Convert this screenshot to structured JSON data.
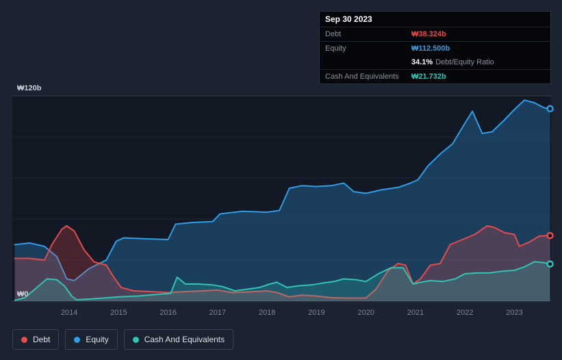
{
  "tooltip": {
    "date": "Sep 30 2023",
    "debt_label": "Debt",
    "debt_value": "₩38.324b",
    "equity_label": "Equity",
    "equity_value": "₩112.500b",
    "ratio_value": "34.1%",
    "ratio_label": "Debt/Equity Ratio",
    "cash_label": "Cash And Equivalents",
    "cash_value": "₩21.732b"
  },
  "legend": {
    "items": [
      {
        "label": "Debt",
        "color": "#e64c4c"
      },
      {
        "label": "Equity",
        "color": "#2f9ee8"
      },
      {
        "label": "Cash And Equivalents",
        "color": "#2fc6b5"
      }
    ]
  },
  "chart_data": {
    "type": "area",
    "title": "",
    "ylabel_top": "₩120b",
    "ylabel_bottom": "₩0",
    "unit": "₩ billions",
    "xlim": [
      2012.85,
      2023.74
    ],
    "ylim": [
      0,
      120
    ],
    "gridlines": [
      120,
      96,
      72,
      48,
      24,
      0
    ],
    "x_ticks": [
      2014,
      2015,
      2016,
      2017,
      2018,
      2019,
      2020,
      2021,
      2022,
      2023
    ],
    "legend_position": "bottom-left",
    "series": [
      {
        "name": "Equity",
        "color": "#2f9ee8",
        "fill": "rgba(47,158,232,0.28)",
        "points": [
          [
            2012.9,
            33
          ],
          [
            2013.2,
            34
          ],
          [
            2013.5,
            32
          ],
          [
            2013.75,
            26
          ],
          [
            2013.95,
            13
          ],
          [
            2014.1,
            12
          ],
          [
            2014.4,
            19
          ],
          [
            2014.75,
            24
          ],
          [
            2014.95,
            35
          ],
          [
            2015.1,
            37
          ],
          [
            2015.5,
            36.5
          ],
          [
            2016.0,
            36
          ],
          [
            2016.15,
            45
          ],
          [
            2016.5,
            46
          ],
          [
            2016.9,
            46.5
          ],
          [
            2017.05,
            51
          ],
          [
            2017.5,
            52.5
          ],
          [
            2018.0,
            52
          ],
          [
            2018.25,
            53
          ],
          [
            2018.45,
            66
          ],
          [
            2018.7,
            67.5
          ],
          [
            2019.0,
            67
          ],
          [
            2019.3,
            67.5
          ],
          [
            2019.55,
            69
          ],
          [
            2019.75,
            64
          ],
          [
            2020.0,
            63
          ],
          [
            2020.3,
            65
          ],
          [
            2020.65,
            66.5
          ],
          [
            2020.9,
            69
          ],
          [
            2021.05,
            71
          ],
          [
            2021.25,
            79
          ],
          [
            2021.5,
            86
          ],
          [
            2021.75,
            92
          ],
          [
            2022.0,
            104
          ],
          [
            2022.15,
            111
          ],
          [
            2022.35,
            98
          ],
          [
            2022.55,
            99
          ],
          [
            2022.8,
            106
          ],
          [
            2023.0,
            112
          ],
          [
            2023.2,
            117.5
          ],
          [
            2023.4,
            116
          ],
          [
            2023.6,
            113
          ],
          [
            2023.72,
            112.5
          ]
        ]
      },
      {
        "name": "Debt",
        "color": "#e64c4c",
        "fill": "rgba(230,76,76,0.25)",
        "points": [
          [
            2012.9,
            25
          ],
          [
            2013.2,
            25
          ],
          [
            2013.5,
            24
          ],
          [
            2013.65,
            33
          ],
          [
            2013.85,
            42
          ],
          [
            2013.95,
            44
          ],
          [
            2014.1,
            41
          ],
          [
            2014.3,
            30
          ],
          [
            2014.5,
            23
          ],
          [
            2014.75,
            21
          ],
          [
            2014.9,
            14
          ],
          [
            2015.05,
            8
          ],
          [
            2015.3,
            6
          ],
          [
            2015.7,
            5.5
          ],
          [
            2016.0,
            5
          ],
          [
            2016.3,
            5.5
          ],
          [
            2016.7,
            6
          ],
          [
            2017.0,
            6.5
          ],
          [
            2017.3,
            5
          ],
          [
            2017.7,
            5.5
          ],
          [
            2018.0,
            6
          ],
          [
            2018.2,
            5
          ],
          [
            2018.45,
            2.5
          ],
          [
            2018.7,
            3.5
          ],
          [
            2019.0,
            3
          ],
          [
            2019.3,
            2
          ],
          [
            2019.6,
            1.8
          ],
          [
            2020.0,
            1.8
          ],
          [
            2020.2,
            7
          ],
          [
            2020.45,
            18
          ],
          [
            2020.65,
            22
          ],
          [
            2020.8,
            21
          ],
          [
            2020.95,
            10
          ],
          [
            2021.1,
            13
          ],
          [
            2021.3,
            21
          ],
          [
            2021.5,
            22
          ],
          [
            2021.7,
            33
          ],
          [
            2021.95,
            36
          ],
          [
            2022.2,
            39
          ],
          [
            2022.45,
            44
          ],
          [
            2022.6,
            43
          ],
          [
            2022.8,
            40
          ],
          [
            2023.0,
            39
          ],
          [
            2023.1,
            32
          ],
          [
            2023.3,
            34.5
          ],
          [
            2023.5,
            38
          ],
          [
            2023.72,
            38.324
          ]
        ]
      },
      {
        "name": "Cash And Equivalents",
        "color": "#2fc6b5",
        "fill": "rgba(47,198,181,0.22)",
        "points": [
          [
            2012.9,
            0.5
          ],
          [
            2013.1,
            2
          ],
          [
            2013.35,
            8
          ],
          [
            2013.55,
            13
          ],
          [
            2013.75,
            12.5
          ],
          [
            2013.9,
            9
          ],
          [
            2014.05,
            3
          ],
          [
            2014.15,
            0.8
          ],
          [
            2014.4,
            1.2
          ],
          [
            2014.7,
            1.8
          ],
          [
            2015.0,
            2.5
          ],
          [
            2015.4,
            3
          ],
          [
            2015.8,
            4
          ],
          [
            2016.05,
            4.5
          ],
          [
            2016.18,
            14
          ],
          [
            2016.35,
            10
          ],
          [
            2016.6,
            10
          ],
          [
            2016.9,
            9.5
          ],
          [
            2017.1,
            8.5
          ],
          [
            2017.35,
            6
          ],
          [
            2017.6,
            7
          ],
          [
            2017.85,
            8
          ],
          [
            2018.05,
            10
          ],
          [
            2018.2,
            11
          ],
          [
            2018.4,
            8
          ],
          [
            2018.65,
            9
          ],
          [
            2018.9,
            9.5
          ],
          [
            2019.1,
            10.5
          ],
          [
            2019.35,
            11.5
          ],
          [
            2019.55,
            13
          ],
          [
            2019.8,
            12.5
          ],
          [
            2020.0,
            11.5
          ],
          [
            2020.25,
            16
          ],
          [
            2020.5,
            19.5
          ],
          [
            2020.75,
            19.5
          ],
          [
            2020.95,
            10
          ],
          [
            2021.1,
            11
          ],
          [
            2021.3,
            12
          ],
          [
            2021.55,
            11.5
          ],
          [
            2021.8,
            13
          ],
          [
            2022.0,
            16
          ],
          [
            2022.25,
            16.5
          ],
          [
            2022.5,
            16.5
          ],
          [
            2022.75,
            17.5
          ],
          [
            2023.0,
            18
          ],
          [
            2023.2,
            20
          ],
          [
            2023.4,
            23
          ],
          [
            2023.6,
            22.5
          ],
          [
            2023.72,
            21.732
          ]
        ]
      }
    ]
  }
}
